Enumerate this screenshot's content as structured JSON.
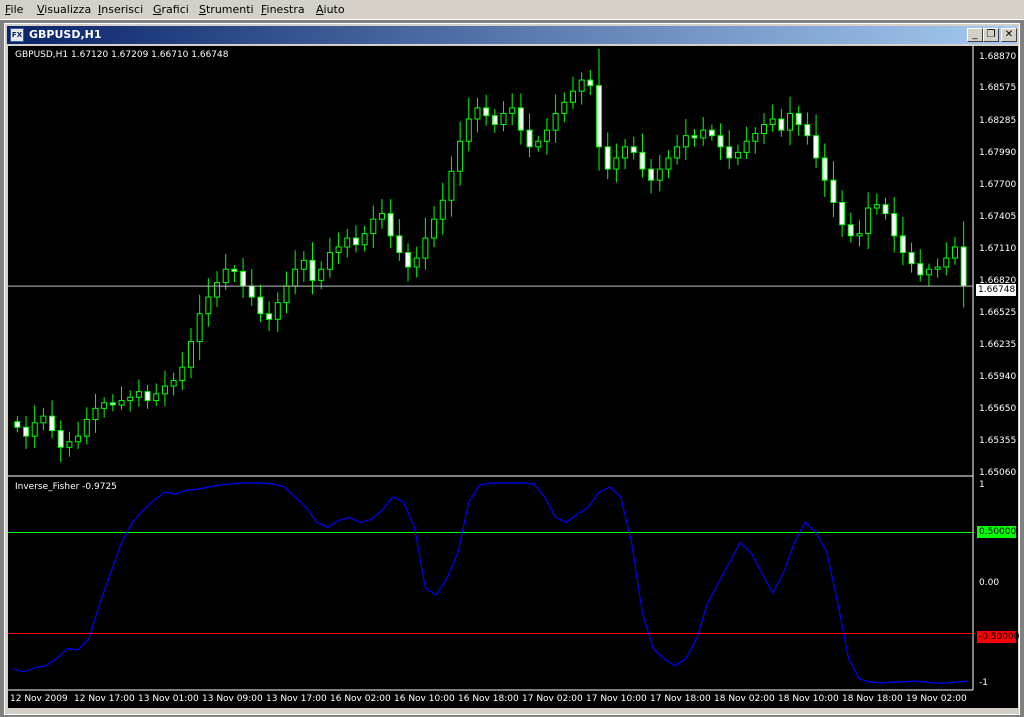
{
  "menu": {
    "items": [
      {
        "first": "F",
        "rest": "ile"
      },
      {
        "first": "V",
        "rest": "isualizza"
      },
      {
        "first": "I",
        "rest": "nserisci"
      },
      {
        "first": "G",
        "rest": "rafici"
      },
      {
        "first": "S",
        "rest": "trumenti"
      },
      {
        "first": "F",
        "rest": "inestra"
      },
      {
        "first": "A",
        "rest": "iuto"
      }
    ]
  },
  "window": {
    "title": "GBPUSD,H1",
    "icon_label": "FX",
    "buttons": {
      "minimize": "_",
      "restore": "❐",
      "close": "✕"
    }
  },
  "chart": {
    "ohlc_text": "GBPUSD,H1  1.67120 1.67209 1.66710 1.66748",
    "indicator_label": "Inverse_Fisher -0.9725",
    "current_price": "1.66748",
    "price_ticks": [
      "1.68870",
      "1.68575",
      "1.68285",
      "1.67990",
      "1.67700",
      "1.67405",
      "1.67110",
      "1.66820",
      "1.66525",
      "1.66235",
      "1.65940",
      "1.65650",
      "1.65355",
      "1.65060"
    ],
    "indicator_ticks": [
      "1",
      "0.00",
      "-1"
    ],
    "level_high": "0.50000",
    "level_low": "-0.50000",
    "date_ticks": [
      "12 Nov 2009",
      "12 Nov 17:00",
      "13 Nov 01:00",
      "13 Nov 09:00",
      "13 Nov 17:00",
      "16 Nov 02:00",
      "16 Nov 10:00",
      "16 Nov 18:00",
      "17 Nov 02:00",
      "17 Nov 10:00",
      "17 Nov 18:00",
      "18 Nov 02:00",
      "18 Nov 10:00",
      "18 Nov 18:00",
      "19 Nov 02:00"
    ],
    "colors": {
      "background": "#000000",
      "candle_up": "#000000",
      "candle_down": "#ffffff",
      "wick": "#00ff00",
      "indicator": "#0000ff",
      "level_high": "#00ff00",
      "level_low": "#ff0000",
      "grid": "#ffffff"
    }
  },
  "chart_data": {
    "type": "candlestick",
    "symbol": "GBPUSD",
    "timeframe": "H1",
    "ylim": [
      1.6506,
      1.6887
    ],
    "closes": [
      1.6548,
      1.654,
      1.6552,
      1.6558,
      1.6545,
      1.653,
      1.6535,
      1.654,
      1.6555,
      1.6565,
      1.657,
      1.6568,
      1.6572,
      1.6575,
      1.658,
      1.6572,
      1.6578,
      1.6585,
      1.659,
      1.6602,
      1.6625,
      1.665,
      1.6665,
      1.6678,
      1.669,
      1.6688,
      1.6675,
      1.6665,
      1.665,
      1.6645,
      1.666,
      1.6675,
      1.669,
      1.6698,
      1.668,
      1.669,
      1.6705,
      1.671,
      1.6718,
      1.6712,
      1.6722,
      1.6735,
      1.674,
      1.672,
      1.6705,
      1.6692,
      1.67,
      1.6718,
      1.6735,
      1.6752,
      1.6778,
      1.6805,
      1.6825,
      1.6835,
      1.6828,
      1.682,
      1.683,
      1.6835,
      1.6815,
      1.68,
      1.6805,
      1.6815,
      1.683,
      1.684,
      1.685,
      1.686,
      1.6855,
      1.68,
      1.678,
      1.679,
      1.68,
      1.6795,
      1.678,
      1.677,
      1.678,
      1.679,
      1.68,
      1.681,
      1.6808,
      1.6815,
      1.681,
      1.68,
      1.679,
      1.6795,
      1.6805,
      1.6812,
      1.682,
      1.6825,
      1.6815,
      1.683,
      1.682,
      1.681,
      1.679,
      1.677,
      1.675,
      1.673,
      1.672,
      1.6722,
      1.6745,
      1.6748,
      1.674,
      1.672,
      1.6705,
      1.6695,
      1.6685,
      1.669,
      1.6692,
      1.67,
      1.671,
      1.6675
    ],
    "indicator": {
      "name": "Inverse_Fisher",
      "last_value": -0.9725,
      "levels": [
        0.5,
        -0.5
      ],
      "ylim": [
        -1,
        1
      ],
      "values": [
        -0.85,
        -0.88,
        -0.84,
        -0.82,
        -0.75,
        -0.65,
        -0.66,
        -0.55,
        -0.2,
        0.1,
        0.4,
        0.6,
        0.72,
        0.82,
        0.9,
        0.88,
        0.92,
        0.93,
        0.95,
        0.97,
        0.98,
        0.99,
        0.99,
        0.99,
        0.98,
        0.95,
        0.85,
        0.75,
        0.6,
        0.55,
        0.62,
        0.65,
        0.6,
        0.63,
        0.72,
        0.85,
        0.8,
        0.55,
        -0.05,
        -0.12,
        0.05,
        0.3,
        0.8,
        0.97,
        0.99,
        0.99,
        0.99,
        0.99,
        0.98,
        0.85,
        0.65,
        0.6,
        0.68,
        0.75,
        0.9,
        0.95,
        0.85,
        0.4,
        -0.3,
        -0.65,
        -0.75,
        -0.82,
        -0.75,
        -0.55,
        -0.2,
        0.0,
        0.2,
        0.4,
        0.3,
        0.1,
        -0.1,
        0.1,
        0.4,
        0.6,
        0.5,
        0.3,
        -0.2,
        -0.75,
        -0.95,
        -0.98,
        -0.99,
        -0.98,
        -0.98,
        -0.97,
        -0.98,
        -0.99,
        -0.99,
        -0.98,
        -0.97
      ]
    }
  }
}
